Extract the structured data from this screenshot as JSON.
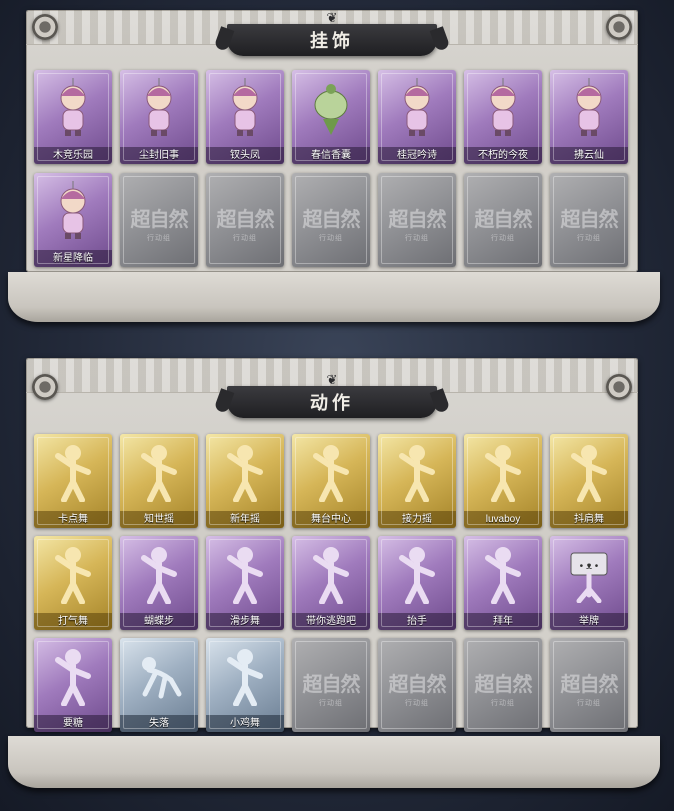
{
  "sections": [
    {
      "title": "挂饰",
      "items": [
        {
          "label": "木竞乐园",
          "rarity": "purple",
          "icon": "charm-figure-icon"
        },
        {
          "label": "尘封旧事",
          "rarity": "purple",
          "icon": "charm-figure-icon"
        },
        {
          "label": "钗头凤",
          "rarity": "purple",
          "icon": "charm-figure-icon"
        },
        {
          "label": "春信香囊",
          "rarity": "purple",
          "icon": "sachet-icon"
        },
        {
          "label": "桂冠吟诗",
          "rarity": "purple",
          "icon": "charm-figure-icon"
        },
        {
          "label": "不朽的今夜",
          "rarity": "purple",
          "icon": "charm-figure-icon"
        },
        {
          "label": "拂云仙",
          "rarity": "purple",
          "icon": "charm-figure-icon"
        },
        {
          "label": "新星降临",
          "rarity": "purple",
          "icon": "charm-figure-icon"
        },
        {
          "label": "",
          "rarity": "empty"
        },
        {
          "label": "",
          "rarity": "empty"
        },
        {
          "label": "",
          "rarity": "empty"
        },
        {
          "label": "",
          "rarity": "empty"
        },
        {
          "label": "",
          "rarity": "empty"
        },
        {
          "label": "",
          "rarity": "empty"
        }
      ]
    },
    {
      "title": "动作",
      "items": [
        {
          "label": "卡点舞",
          "rarity": "gold",
          "icon": "dance-pose-icon"
        },
        {
          "label": "知世摇",
          "rarity": "gold",
          "icon": "dance-pose-icon"
        },
        {
          "label": "新年摇",
          "rarity": "gold",
          "icon": "dance-pose-icon"
        },
        {
          "label": "舞台中心",
          "rarity": "gold",
          "icon": "dance-pose-icon"
        },
        {
          "label": "接力摇",
          "rarity": "gold",
          "icon": "dance-pose-icon"
        },
        {
          "label": "luvaboy",
          "rarity": "gold",
          "icon": "dance-pose-icon"
        },
        {
          "label": "抖肩舞",
          "rarity": "gold",
          "icon": "dance-pose-icon"
        },
        {
          "label": "打气舞",
          "rarity": "gold",
          "icon": "dance-pose-icon"
        },
        {
          "label": "蝴蝶步",
          "rarity": "purple",
          "icon": "dance-pose-icon"
        },
        {
          "label": "滑步舞",
          "rarity": "purple",
          "icon": "dance-pose-icon"
        },
        {
          "label": "带你逃跑吧",
          "rarity": "purple",
          "icon": "dance-pose-icon"
        },
        {
          "label": "抬手",
          "rarity": "purple",
          "icon": "pose-silhouette-icon"
        },
        {
          "label": "拜年",
          "rarity": "purple",
          "icon": "pose-silhouette-icon"
        },
        {
          "label": "举牌",
          "rarity": "purple",
          "icon": "sign-holding-icon"
        },
        {
          "label": "要糖",
          "rarity": "purple",
          "icon": "pose-silhouette-icon"
        },
        {
          "label": "失落",
          "rarity": "blue",
          "icon": "crawl-pose-icon"
        },
        {
          "label": "小鸡舞",
          "rarity": "blue",
          "icon": "dance-pose-icon"
        },
        {
          "label": "",
          "rarity": "empty"
        },
        {
          "label": "",
          "rarity": "empty"
        },
        {
          "label": "",
          "rarity": "empty"
        },
        {
          "label": "",
          "rarity": "empty"
        }
      ]
    }
  ],
  "empty_watermark": {
    "main": "超自然",
    "sub": "行动组"
  },
  "colors": {
    "purple": "#a07bbd",
    "gold": "#d6b658",
    "blue": "#9fb0c2",
    "empty": "#8e8f93",
    "banner": "#2b2b2e"
  }
}
